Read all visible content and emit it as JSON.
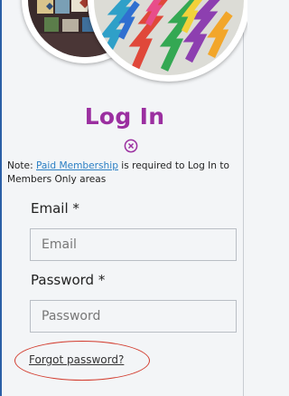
{
  "page": {
    "title": "Log In",
    "note_prefix": "Note: ",
    "note_link": "Paid Membership",
    "note_suffix": " is required to Log In to Members Only areas",
    "accent_color": "#9b2fa0",
    "link_color": "#2b7fc4",
    "close_icon": "close-circle-icon"
  },
  "form": {
    "email_label": "Email *",
    "email_placeholder": "Email",
    "password_label": "Password *",
    "password_placeholder": "Password",
    "forgot_link": "Forgot password?",
    "highlight_color": "#d23a2c"
  }
}
